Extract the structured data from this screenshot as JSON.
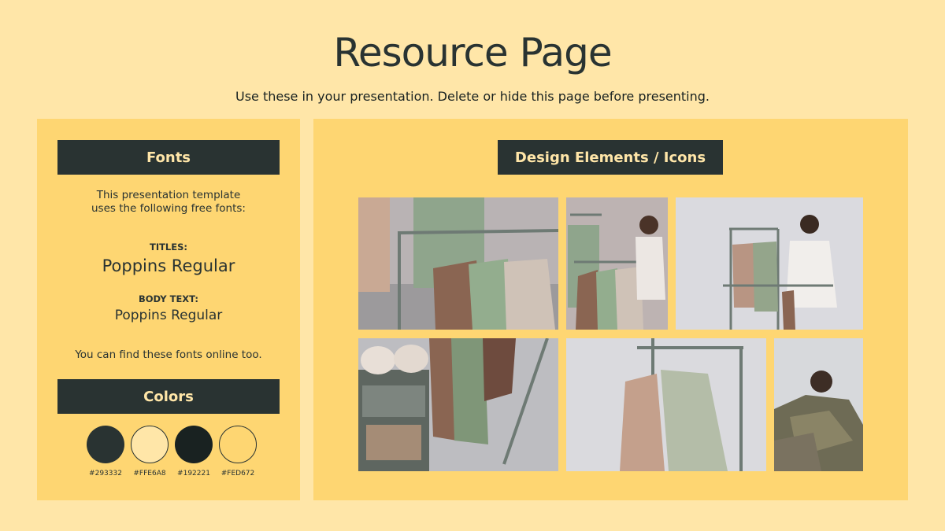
{
  "page": {
    "title": "Resource Page",
    "subtitle": "Use these in your presentation. Delete or hide this page before presenting."
  },
  "fonts_panel": {
    "header": "Fonts",
    "intro_line1": "This presentation template",
    "intro_line2": "uses the following free fonts:",
    "titles_label": "TITLES:",
    "titles_font": "Poppins Regular",
    "body_label": "BODY TEXT:",
    "body_font": "Poppins Regular",
    "find_text": "You can find these fonts online too."
  },
  "colors_panel": {
    "header": "Colors",
    "swatches": [
      {
        "hex": "#293332",
        "label": "#293332"
      },
      {
        "hex": "#FFE6A8",
        "label": "#FFE6A8"
      },
      {
        "hex": "#192221",
        "label": "#192221"
      },
      {
        "hex": "#FED672",
        "label": "#FED672"
      }
    ]
  },
  "design_panel": {
    "header": "Design Elements / Icons"
  }
}
